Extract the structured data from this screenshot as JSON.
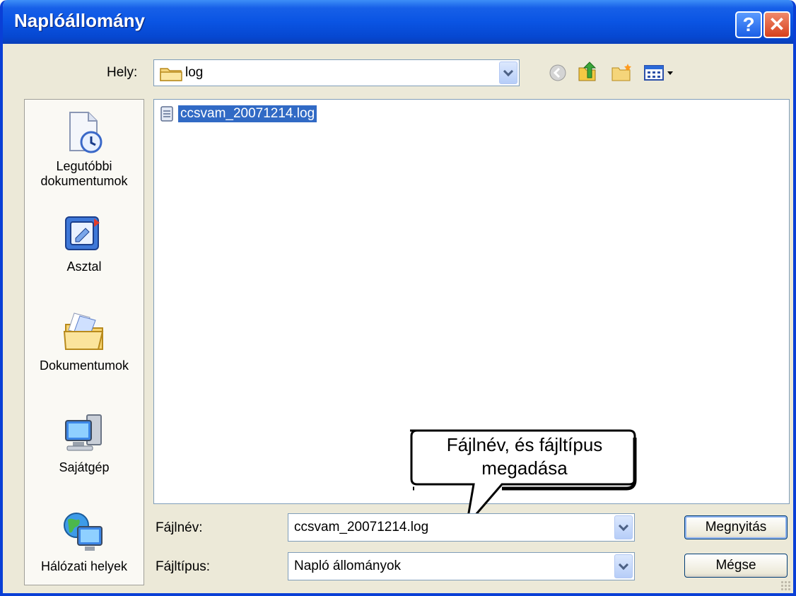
{
  "window": {
    "title": "Naplóállomány",
    "help_label": "?",
    "close_label": "✕"
  },
  "location": {
    "label": "Hely:",
    "value": "log"
  },
  "toolbar": {
    "icons": [
      "back-icon",
      "up-folder-icon",
      "new-folder-icon",
      "views-menu-icon"
    ]
  },
  "places": [
    {
      "label": "Legutóbbi dokumentumok",
      "icon": "recent-documents-icon"
    },
    {
      "label": "Asztal",
      "icon": "desktop-icon"
    },
    {
      "label": "Dokumentumok",
      "icon": "my-documents-icon"
    },
    {
      "label": "Sajátgép",
      "icon": "my-computer-icon"
    },
    {
      "label": "Hálózati helyek",
      "icon": "network-places-icon"
    }
  ],
  "files": [
    {
      "name": "ccsvam_20071214.log",
      "icon": "text-file-icon",
      "selected": true
    }
  ],
  "filename": {
    "label": "Fájlnév:",
    "value": "ccsvam_20071214.log"
  },
  "filetype": {
    "label": "Fájltípus:",
    "value": "Napló állományok"
  },
  "buttons": {
    "open": "Megnyitás",
    "cancel": "Mégse"
  },
  "callout": {
    "line1": "Fájlnév, és fájltípus",
    "line2": "megadása"
  },
  "colors": {
    "title_bar": "#0a54e3",
    "selection": "#316ac5",
    "dialog_bg": "#ece9d8"
  }
}
